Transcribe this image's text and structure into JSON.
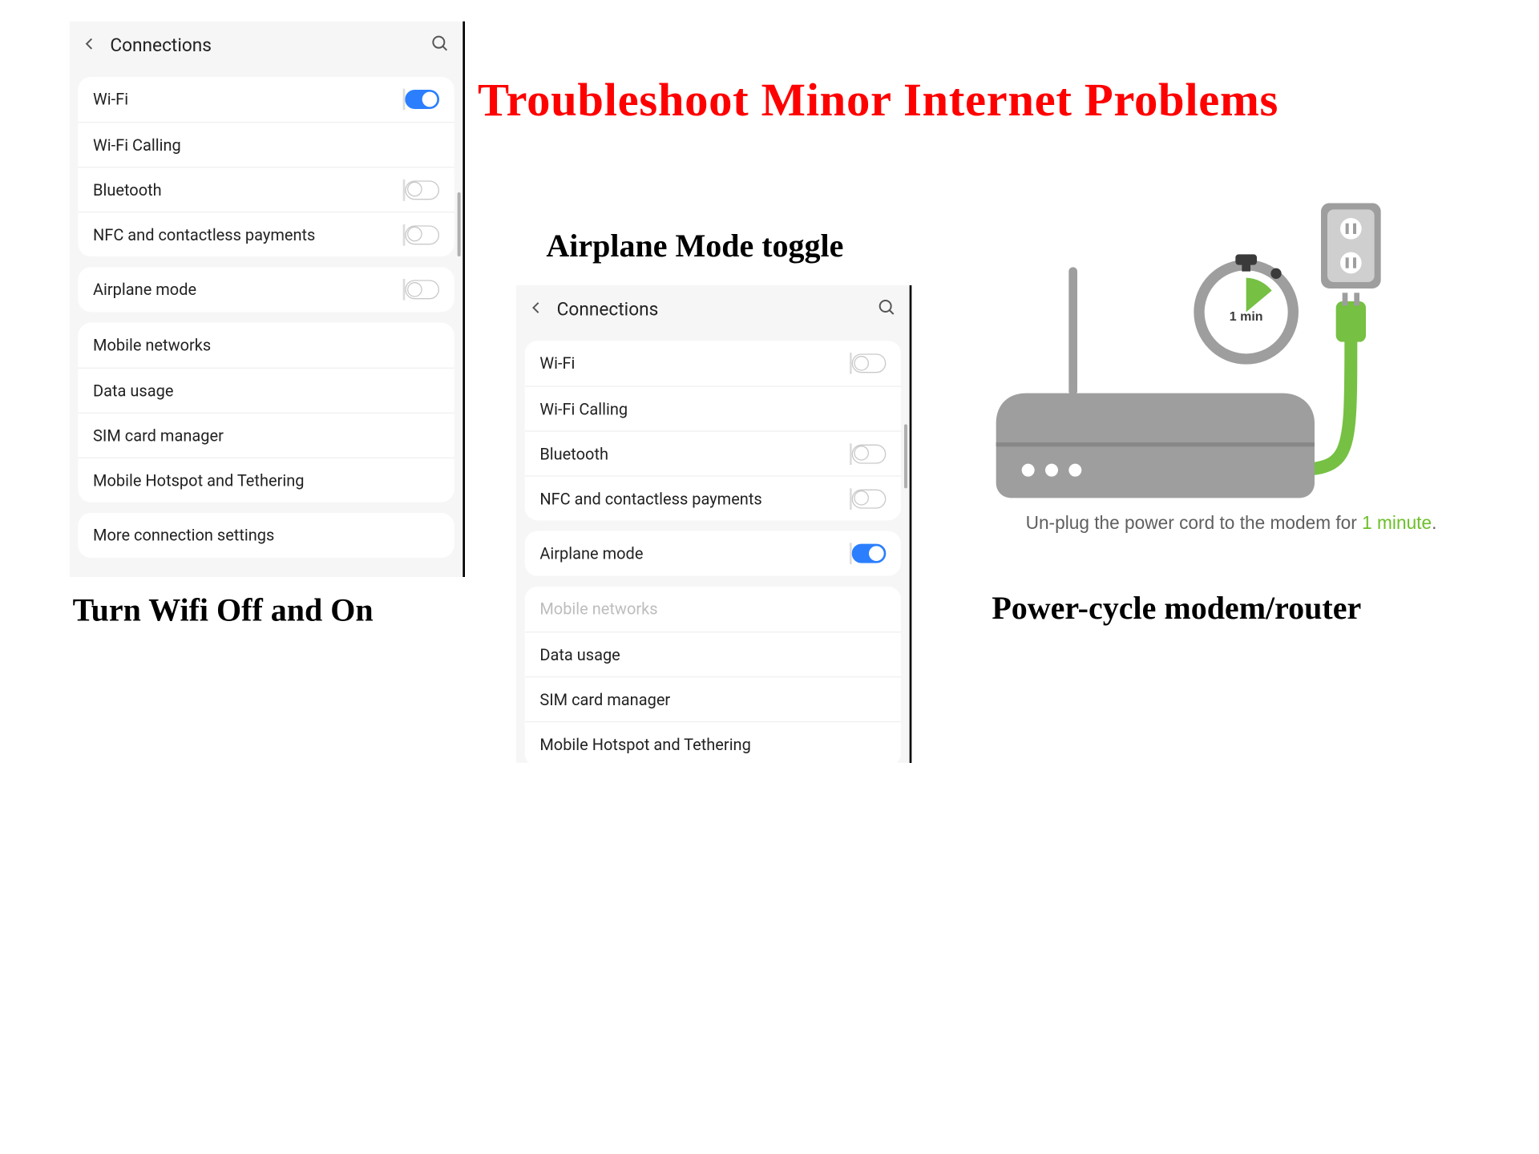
{
  "main_title": "Troubleshoot Minor Internet Problems",
  "captions": {
    "wifi": "Turn Wifi Off and On",
    "airplane": "Airplane Mode toggle",
    "power": "Power-cycle modem/router"
  },
  "phone_left": {
    "header": "Connections",
    "groups": [
      [
        {
          "label": "Wi-Fi",
          "toggle": "on"
        },
        {
          "label": "Wi-Fi Calling"
        },
        {
          "label": "Bluetooth",
          "toggle": "off"
        },
        {
          "label": "NFC and contactless payments",
          "toggle": "off"
        }
      ],
      [
        {
          "label": "Airplane mode",
          "toggle": "off"
        }
      ],
      [
        {
          "label": "Mobile networks"
        },
        {
          "label": "Data usage"
        },
        {
          "label": "SIM card manager"
        },
        {
          "label": "Mobile Hotspot and Tethering"
        }
      ],
      [
        {
          "label": "More connection settings"
        }
      ]
    ]
  },
  "phone_mid": {
    "header": "Connections",
    "groups": [
      [
        {
          "label": "Wi-Fi",
          "toggle": "off"
        },
        {
          "label": "Wi-Fi Calling"
        },
        {
          "label": "Bluetooth",
          "toggle": "off"
        },
        {
          "label": "NFC and contactless payments",
          "toggle": "off"
        }
      ],
      [
        {
          "label": "Airplane mode",
          "toggle": "on"
        }
      ],
      [
        {
          "label": "Mobile networks",
          "disabled": true
        },
        {
          "label": "Data usage"
        },
        {
          "label": "SIM card manager"
        },
        {
          "label": "Mobile Hotspot and Tethering"
        }
      ]
    ]
  },
  "router": {
    "note_pre": "Un-plug the power cord to the modem for ",
    "note_em": "1 minute",
    "note_post": ".",
    "timer_label": "1 min"
  }
}
